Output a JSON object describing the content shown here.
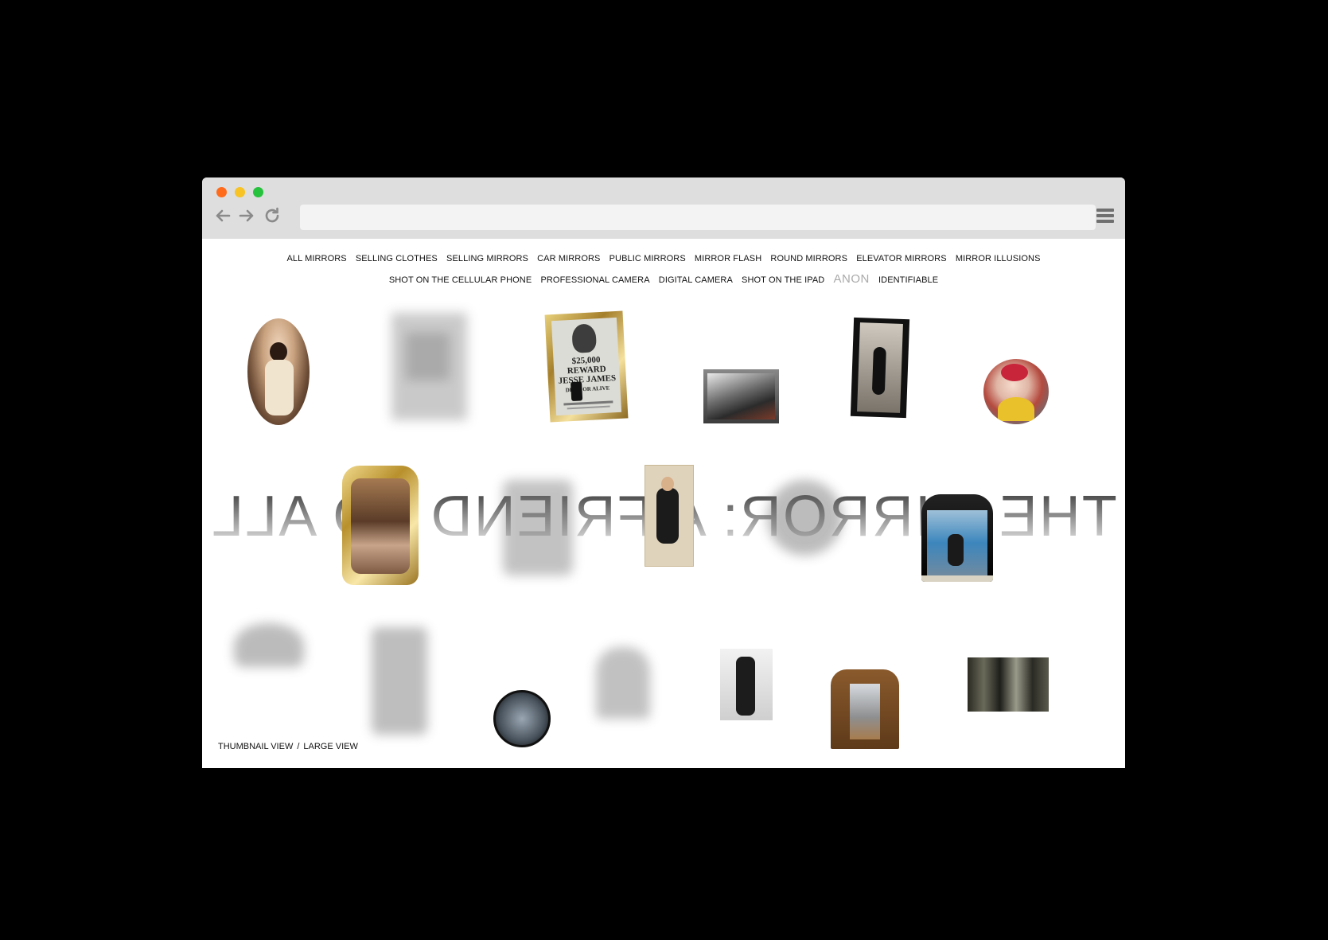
{
  "window": {
    "controls": [
      "close",
      "minimize",
      "maximize"
    ],
    "colors": {
      "close": "#ff6b1a",
      "minimize": "#f7c325",
      "maximize": "#27c23d",
      "chrome": "#dedede"
    },
    "url": ""
  },
  "toolbar": {
    "back_icon": "arrow-left-icon",
    "forward_icon": "arrow-right-icon",
    "reload_icon": "reload-icon",
    "menu_icon": "hamburger-menu-icon"
  },
  "categories": {
    "row1": [
      "ALL MIRRORS",
      "SELLING CLOTHES",
      "SELLING MIRRORS",
      "CAR MIRRORS",
      "PUBLIC MIRRORS",
      "MIRROR FLASH",
      "ROUND MIRRORS",
      "ELEVATOR MIRRORS",
      "MIRROR ILLUSIONS"
    ],
    "row2": [
      "SHOT ON THE CELLULAR PHONE",
      "PROFESSIONAL CAMERA",
      "DIGITAL CAMERA",
      "SHOT ON THE IPAD",
      "ANON",
      "IDENTIFIABLE"
    ],
    "selected": "ANON"
  },
  "headline": "THE MIRROR: A FRIEND TO ALL",
  "headline_mirrored": true,
  "poster": {
    "reward": "$25,000 REWARD",
    "name": "JESSE JAMES",
    "sub": "DEAD OR ALIVE"
  },
  "thumbnails": [
    "oval-mirror-selfie",
    "blurred-mirror",
    "framed-reward-poster-mirror",
    "wall-mirror-bedroom",
    "tall-door-mirror",
    "round-mirror-clown",
    "ornate-gold-mirror",
    "blurred-mirror",
    "hallway-mirror-selfie",
    "blurred-round-mirror",
    "dresser-mirror-selfie",
    "blurred-car-mirror",
    "blurred-tall-mirror",
    "round-convex-mirror",
    "blurred-mirror",
    "closet-mirror-selfie",
    "wooden-armoire-mirror",
    "mirror-illusion"
  ],
  "footer": {
    "thumbnail_view": "THUMBNAIL VIEW",
    "separator": "/",
    "large_view": "LARGE VIEW"
  }
}
